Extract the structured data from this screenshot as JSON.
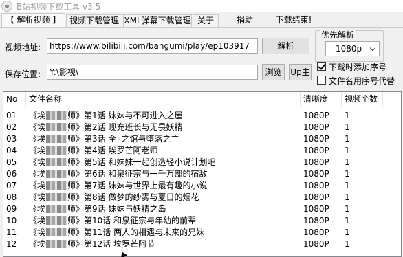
{
  "window": {
    "title": "B站视频下载工具 v3.5"
  },
  "tabs": [
    {
      "label": "【 解析视频 】"
    },
    {
      "label": "视频下载管理"
    },
    {
      "label": "XML弹幕下载管理"
    },
    {
      "label": "关于"
    },
    {
      "label": "捐助"
    },
    {
      "label": "下载结束!"
    }
  ],
  "form": {
    "url_label": "视频地址:",
    "url_value": "https://www.bilibili.com/bangumi/play/ep103917",
    "parse_button": "解析",
    "save_label": "保存位置:",
    "save_value": "Y:\\影视\\",
    "browse_button": "浏览",
    "up_button": "Up主"
  },
  "quality": {
    "group_title": "优先解析",
    "selected": "1080p",
    "icon": "chevron-down-icon"
  },
  "options": {
    "add_index_label": "下载时添加序号",
    "add_index_checked": true,
    "use_index_label": "文件名用序号代替",
    "use_index_checked": false
  },
  "table": {
    "columns": [
      "No",
      "文件名称",
      "清晰度",
      "视频个数"
    ],
    "rows": [
      {
        "no": "01",
        "prefix": "《埃",
        "suffix": "师》第1话 妹妹与不可进入之屋",
        "quality": "1080P",
        "count": "1"
      },
      {
        "no": "02",
        "prefix": "《埃",
        "suffix": "师》第2话 现充班长与无畏妖精",
        "quality": "1080P",
        "count": "1"
      },
      {
        "no": "03",
        "prefix": "《埃",
        "suffix": "师》第3话 全◦之馆与堕落之主",
        "quality": "1080P",
        "count": "1"
      },
      {
        "no": "04",
        "prefix": "《埃",
        "suffix": "师》第4话 埃罗芒阿老师",
        "quality": "1080P",
        "count": "1"
      },
      {
        "no": "05",
        "prefix": "《埃",
        "suffix": "师》第5话 和妹妹一起创造轻小说计划吧",
        "quality": "1080P",
        "count": "1"
      },
      {
        "no": "06",
        "prefix": "《埃",
        "suffix": "师》第6话 和泉征宗与一千万部的宿敌",
        "quality": "1080P",
        "count": "1"
      },
      {
        "no": "07",
        "prefix": "《埃",
        "suffix": "师》第7话 妹妹与世界上最有趣的小说",
        "quality": "1080P",
        "count": "1"
      },
      {
        "no": "08",
        "prefix": "《埃",
        "suffix": "师》第8话 做梦的纱雾与夏日的烟花",
        "quality": "1080P",
        "count": "1"
      },
      {
        "no": "09",
        "prefix": "《埃",
        "suffix": "师》第9话 妹妹与妖精之岛",
        "quality": "1080P",
        "count": "1"
      },
      {
        "no": "10",
        "prefix": "《埃",
        "suffix": "师》第10话 和泉征宗与年幼的前辈",
        "quality": "1080P",
        "count": "1"
      },
      {
        "no": "11",
        "prefix": "《埃",
        "suffix": "师》第11话 两人的相遇与未来的兄妹",
        "quality": "1080P",
        "count": "1"
      },
      {
        "no": "12",
        "prefix": "《埃",
        "suffix": "师》第12话 埃罗芒阿节",
        "quality": "1080P",
        "count": "1"
      }
    ]
  }
}
